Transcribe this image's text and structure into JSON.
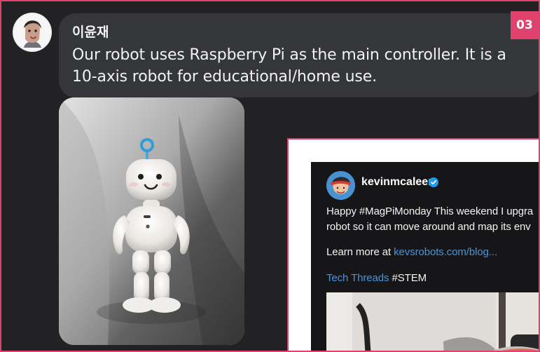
{
  "page": {
    "badge": "03"
  },
  "message": {
    "sender": "이윤재",
    "text": "Our robot uses Raspberry Pi as the main controller. It is a 10-axis robot for educational/home use."
  },
  "attachment": {
    "subject": "white-humanoid-robot-with-blue-antenna"
  },
  "inset_post": {
    "username": "kevinmcaleer",
    "line1": "Happy #MagPiMonday This weekend I upgra",
    "line2": "robot so it can move around and map its env",
    "learn_prefix": "Learn more at ",
    "learn_link": "kevsrobots.com/blog...",
    "tag_link": "Tech Threads",
    "tag_text": " #STEM"
  },
  "colors": {
    "accent": "#e0426e",
    "chat_background": "#222224",
    "bubble": "#353639",
    "link": "#4b95d8"
  },
  "icons": {
    "verified": "verified-check-icon",
    "antenna": "robot-antenna"
  }
}
